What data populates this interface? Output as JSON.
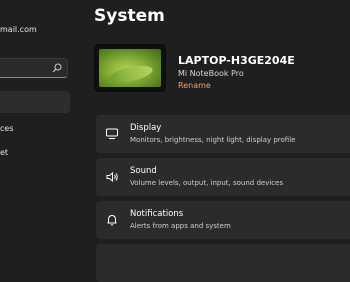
{
  "sidebar": {
    "account_email": "mail.com",
    "search": {
      "value": "",
      "placeholder": ""
    },
    "items": [
      {
        "label": ""
      },
      {
        "label": "ces"
      },
      {
        "label": "et"
      }
    ]
  },
  "header": {
    "title": "System"
  },
  "device": {
    "name": "LAPTOP-H3GE204E",
    "model": "Mi NoteBook Pro",
    "rename_label": "Rename"
  },
  "settings": [
    {
      "title": "Display",
      "description": "Monitors, brightness, night light, display profile",
      "icon": "monitor-icon"
    },
    {
      "title": "Sound",
      "description": "Volume levels, output, input, sound devices",
      "icon": "speaker-icon"
    },
    {
      "title": "Notifications",
      "description": "Alerts from apps and system",
      "icon": "bell-icon"
    }
  ],
  "colors": {
    "background": "#1f1f1f",
    "card": "#2b2b2b",
    "accent": "#f0a56e"
  }
}
